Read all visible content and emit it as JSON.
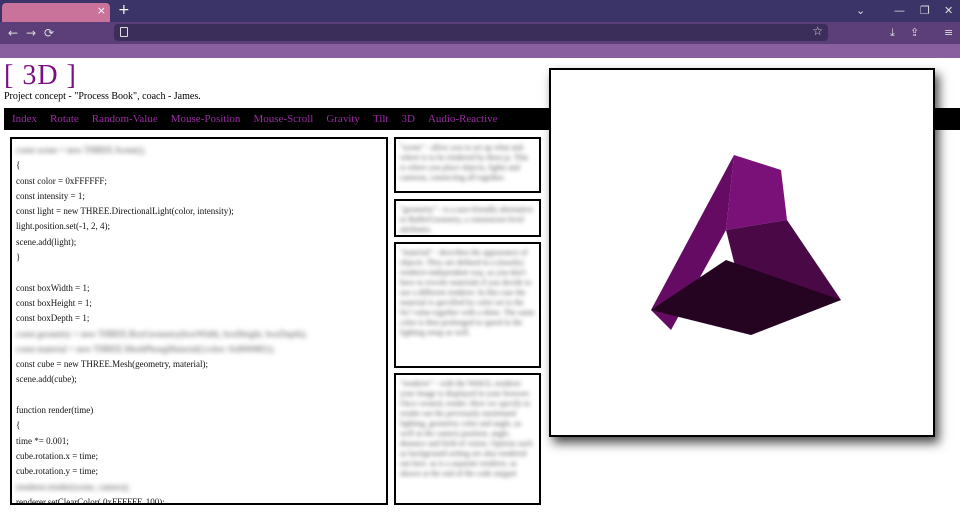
{
  "browser": {
    "tab_close": "×",
    "new_tab": "+",
    "win_down": "⌄",
    "win_min": "—",
    "win_restore": "❐",
    "win_close": "✕",
    "back": "←",
    "forward": "→",
    "reload": "⟳",
    "bookmark": "☆",
    "download": "⤓",
    "extensions": "⇪",
    "menu": "≡"
  },
  "site": {
    "logo": "[ 3D ]",
    "subtitle": "Project concept - \"Process Book\", coach - James.",
    "nav": [
      "Index",
      "Rotate",
      "Random-Value",
      "Mouse-Position",
      "Mouse-Scroll",
      "Gravity",
      "Tilt",
      "3D",
      "Audio-Reactive"
    ]
  },
  "code": [
    {
      "text": "const scene = new THREE.Scene();",
      "blurred": true
    },
    {
      "text": "{",
      "blurred": false
    },
    {
      "text": "const color = 0xFFFFFF;",
      "blurred": false
    },
    {
      "text": "const intensity = 1;",
      "blurred": false
    },
    {
      "text": "const light = new THREE.DirectionalLight(color, intensity);",
      "blurred": false
    },
    {
      "text": "light.position.set(-1, 2, 4);",
      "blurred": false
    },
    {
      "text": "scene.add(light);",
      "blurred": false
    },
    {
      "text": "}",
      "blurred": false
    },
    {
      "text": "",
      "blurred": false
    },
    {
      "text": "const boxWidth = 1;",
      "blurred": false
    },
    {
      "text": "const boxHeight = 1;",
      "blurred": false
    },
    {
      "text": "const boxDepth = 1;",
      "blurred": false
    },
    {
      "text": "const geometry = new THREE.BoxGeometry(boxWidth, boxHeight, boxDepth);",
      "blurred": true
    },
    {
      "text": "const material = new THREE.MeshPhongMaterial({color: 0x800080});",
      "blurred": true
    },
    {
      "text": "const cube = new THREE.Mesh(geometry, material);",
      "blurred": false
    },
    {
      "text": "scene.add(cube);",
      "blurred": false
    },
    {
      "text": "",
      "blurred": false
    },
    {
      "text": "function render(time)",
      "blurred": false
    },
    {
      "text": "{",
      "blurred": false
    },
    {
      "text": "time *= 0.001;",
      "blurred": false
    },
    {
      "text": "cube.rotation.x = time;",
      "blurred": false
    },
    {
      "text": "cube.rotation.y = time;",
      "blurred": false
    },
    {
      "text": "renderer.render(scene, camera);",
      "blurred": true
    },
    {
      "text": "renderer.setClearColor( 0xFFFFFF, 100);",
      "blurred": false
    }
  ],
  "notes": [
    "\"scene\" - allow you to set up what and where is to be rendered by three.js. This is where you place objects, lights and cameras, connecting all together.",
    "\"geometry\" - is a user-friendly alternative to BufferGeometry, a constructor-level attributes.",
    "\"material\" - describes the appearance of objects. They are defined in a (mostly) renderer-independent way, so you don't have to rewrite materials if you decide to use a different renderer. In this case the material is specified by color set to the 0x? value together with a shine. The same color is then prolonged to speed in the lighting setup as well.",
    "\"renderer\" - with the WebGL renderer your image is displayed in your browser. Once created, render. Here we specify to render out the previously mentioned lighting, geometry color and angle, as well as the camera position, angle, distance and field of vision. Options such as background setting are also rendered out here. as is a separate renderer, as shown at the end of the code snippet"
  ],
  "colors": {
    "accent": "#7b0f82",
    "cube_top": "#7a1178",
    "cube_left": "#660b63",
    "cube_right": "#4a0846",
    "cube_bottom": "#240420"
  }
}
